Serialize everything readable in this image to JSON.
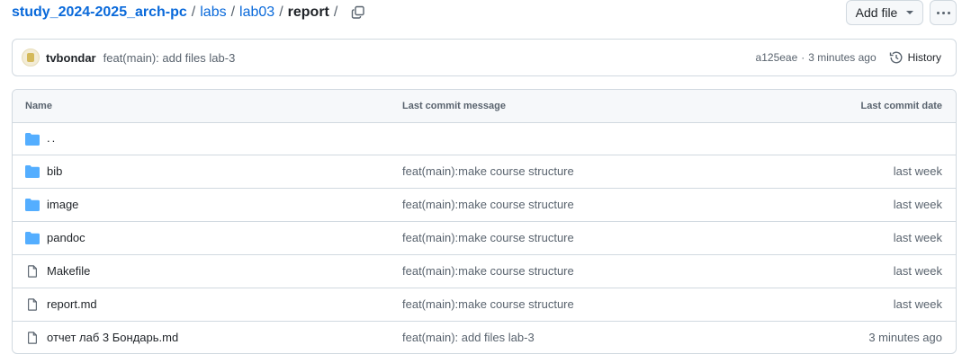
{
  "breadcrumb": {
    "repo": "study_2024-2025_arch-pc",
    "parts": [
      "labs",
      "lab03"
    ],
    "current": "report",
    "sep": "/"
  },
  "actions": {
    "add_file_label": "Add file"
  },
  "commit": {
    "author": "tvbondar",
    "message": "feat(main): add files lab-3",
    "sha": "a125eae",
    "time": "3 minutes ago",
    "dot": "·",
    "history_label": "History"
  },
  "table": {
    "headers": {
      "name": "Name",
      "message": "Last commit message",
      "date": "Last commit date"
    },
    "up": "..",
    "rows": [
      {
        "type": "folder",
        "name": "bib",
        "message": "feat(main):make course structure",
        "date": "last week"
      },
      {
        "type": "folder",
        "name": "image",
        "message": "feat(main):make course structure",
        "date": "last week"
      },
      {
        "type": "folder",
        "name": "pandoc",
        "message": "feat(main):make course structure",
        "date": "last week"
      },
      {
        "type": "file",
        "name": "Makefile",
        "message": "feat(main):make course structure",
        "date": "last week"
      },
      {
        "type": "file",
        "name": "report.md",
        "message": "feat(main):make course structure",
        "date": "last week"
      },
      {
        "type": "file",
        "name": "отчет лаб 3 Бондарь.md",
        "message": "feat(main): add files lab-3",
        "date": "3 minutes ago"
      }
    ]
  },
  "colors": {
    "link": "#0969da",
    "folder": "#54aeff",
    "muted": "#59636e",
    "border": "#d1d9e0"
  }
}
